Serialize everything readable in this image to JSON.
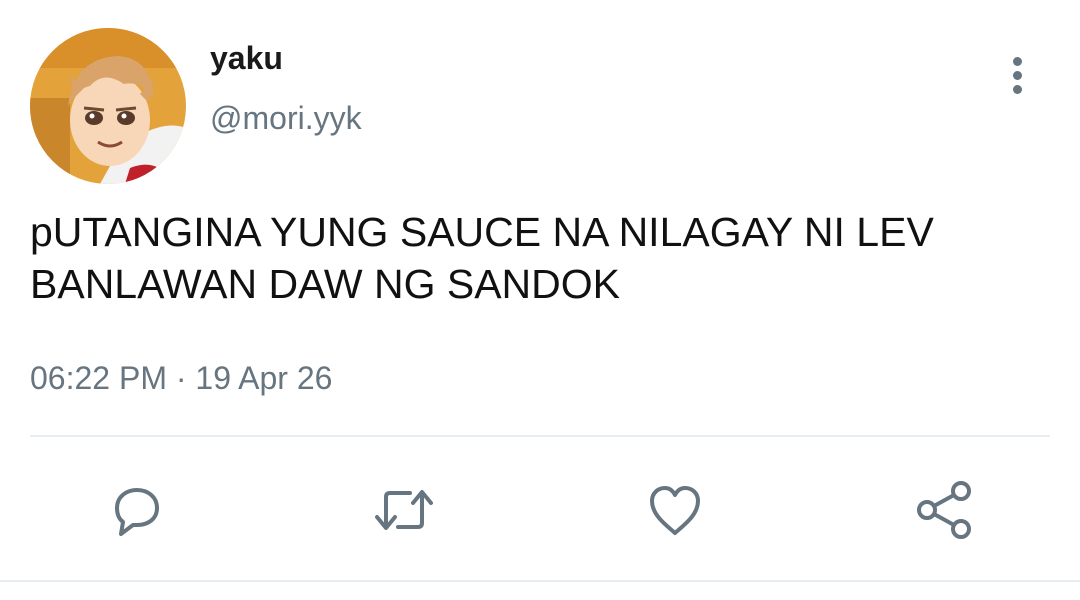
{
  "tweet": {
    "display_name": "yaku",
    "handle": "@mori.yyk",
    "text": "pUTANGINA YUNG SAUCE NA NILAGAY NI LEV BANLAWAN DAW NG SANDOK",
    "timestamp": "06:22 PM · 19 Apr 26"
  },
  "icons": {
    "more": "more-vertical-icon",
    "reply": "reply-icon",
    "retweet": "retweet-icon",
    "like": "heart-icon",
    "share": "share-icon"
  },
  "colors": {
    "text": "#111111",
    "secondary": "#66757f",
    "divider": "#e6ecf0"
  }
}
